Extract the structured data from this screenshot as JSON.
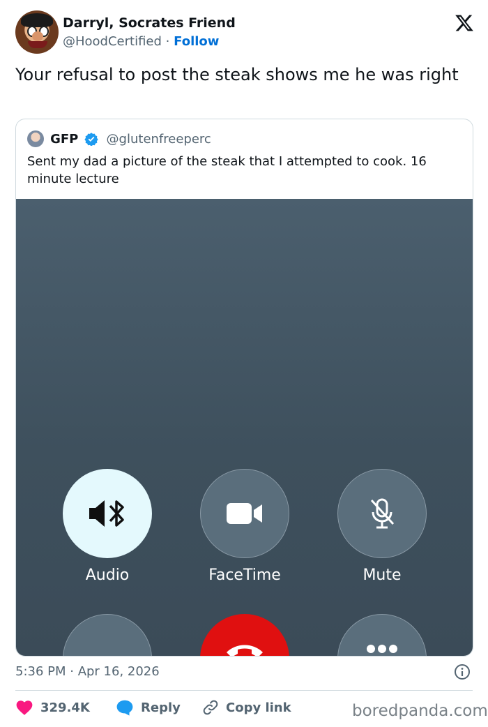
{
  "author": {
    "name": "Darryl, Socrates Friend",
    "handle": "@HoodCertified",
    "separator": "·",
    "follow_label": "Follow"
  },
  "tweet": {
    "text": "Your refusal to post the steak shows me he was right",
    "timestamp": "5:36 PM · Apr 16, 2026"
  },
  "quoted": {
    "name": "GFP",
    "handle": "@glutenfreeperc",
    "text": "Sent my dad a picture of the steak that I attempted to cook. 16 minute lecture",
    "call_screen": {
      "buttons": [
        {
          "label": "Audio",
          "icon": "speaker-bluetooth-icon"
        },
        {
          "label": "FaceTime",
          "icon": "video-camera-icon"
        },
        {
          "label": "Mute",
          "icon": "mic-off-icon"
        }
      ]
    }
  },
  "actions": {
    "likes": "329.4K",
    "reply_label": "Reply",
    "copy_link_label": "Copy link"
  },
  "watermark": "boredpanda.com",
  "colors": {
    "accent": "#006fd6",
    "verified": "#1d9bf0",
    "like": "#f91880",
    "end_call": "#e01010"
  }
}
